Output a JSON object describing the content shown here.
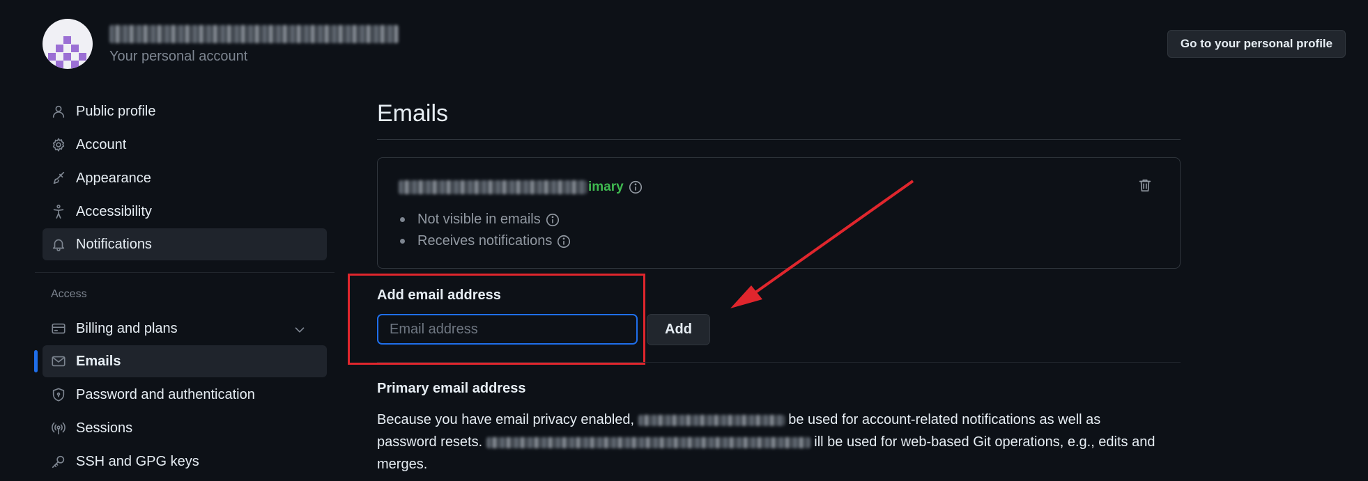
{
  "account": {
    "subtitle": "Your personal account",
    "profile_button": "Go to your personal profile"
  },
  "sidebar": {
    "items": [
      {
        "label": "Public profile",
        "icon": "person-icon"
      },
      {
        "label": "Account",
        "icon": "gear-icon"
      },
      {
        "label": "Appearance",
        "icon": "paintbrush-icon"
      },
      {
        "label": "Accessibility",
        "icon": "accessibility-icon"
      },
      {
        "label": "Notifications",
        "icon": "bell-icon"
      }
    ],
    "section_label": "Access",
    "access_items": [
      {
        "label": "Billing and plans",
        "icon": "credit-card-icon"
      },
      {
        "label": "Emails",
        "icon": "mail-icon",
        "selected": true
      },
      {
        "label": "Password and authentication",
        "icon": "shield-icon"
      },
      {
        "label": "Sessions",
        "icon": "broadcast-icon"
      },
      {
        "label": "SSH and GPG keys",
        "icon": "key-icon"
      }
    ]
  },
  "main": {
    "title": "Emails",
    "email_card": {
      "primary_badge": "Primary",
      "primary_badge_visible": "imary",
      "bullets": [
        "Not visible in emails",
        "Receives notifications"
      ]
    },
    "add_email": {
      "label": "Add email address",
      "placeholder": "Email address",
      "value": "",
      "button": "Add"
    },
    "primary_email": {
      "heading": "Primary email address",
      "text_1": "Because you have email privacy enabled,",
      "text_2": "be used for account-related notifications as well as",
      "text_3": "password resets.",
      "text_4": "ill be used for web-based Git operations, e.g., edits and",
      "text_5": "merges."
    }
  },
  "colors": {
    "background": "#0d1117",
    "accent": "#1f6feb",
    "primary_green": "#3fb950",
    "annotation_red": "#e0262d"
  }
}
